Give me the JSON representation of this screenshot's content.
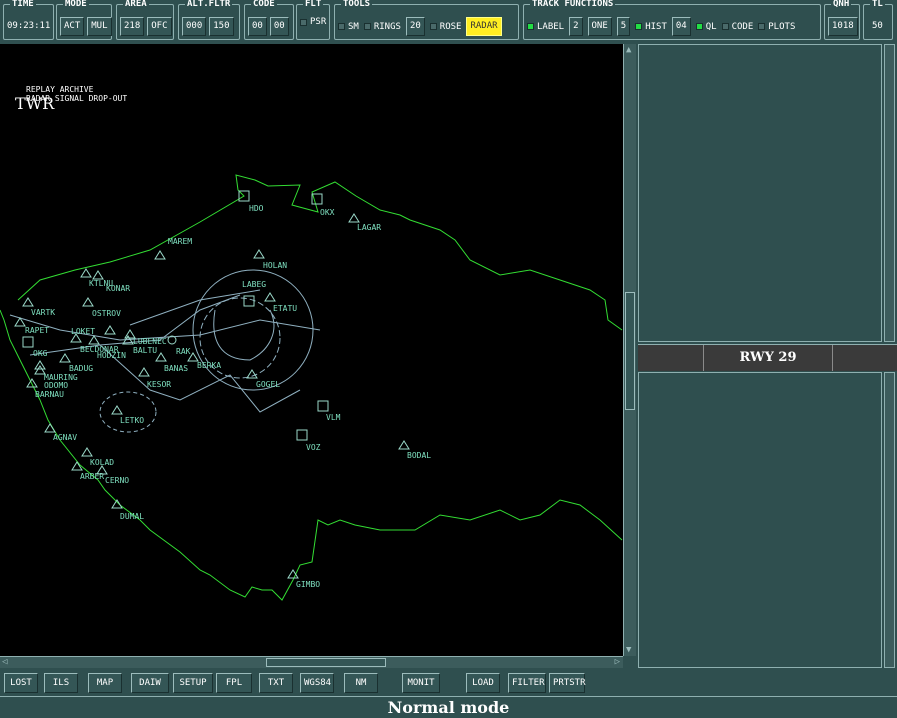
{
  "toolbar": {
    "time": {
      "title": "TIME",
      "value": "09:23:11"
    },
    "mode": {
      "title": "MODE",
      "buttons": [
        "ACT",
        "MUL"
      ]
    },
    "area": {
      "title": "AREA",
      "buttons": [
        "218",
        "OFC"
      ]
    },
    "alt_fltr": {
      "title": "ALT.FLTR",
      "buttons": [
        "000",
        "150"
      ]
    },
    "code": {
      "title": "CODE",
      "buttons": [
        "00",
        "00"
      ]
    },
    "flt": {
      "title": "FLT",
      "psr": {
        "label": "PSR",
        "checked": false
      }
    },
    "tools": {
      "title": "TOOLS",
      "sm": {
        "label": "SM",
        "checked": false
      },
      "rings": {
        "label": "RINGS",
        "checked": false
      },
      "rings_value": "20",
      "rose": {
        "label": "ROSE",
        "checked": false
      },
      "radar": "RADAR"
    },
    "track": {
      "title": "TRACK FUNCTIONS",
      "label": {
        "label": "LABEL",
        "checked": true
      },
      "label_value": "2",
      "one": "ONE",
      "one_value": "5",
      "hist": {
        "label": "HIST",
        "checked": true
      },
      "hist_value": "04",
      "ql": {
        "label": "QL",
        "checked": true
      },
      "code": {
        "label": "CODE",
        "checked": false
      },
      "plots": {
        "label": "PLOTS",
        "checked": false
      }
    },
    "qnh": {
      "title": "QNH",
      "value": "1018"
    },
    "tl": {
      "title": "TL",
      "value": "50"
    }
  },
  "map": {
    "title": "TWR",
    "messages": [
      "REPLAY ARCHIVE",
      "RADAR SIGNAL DROP-OUT"
    ],
    "waypoints": [
      "HDO",
      "OKX",
      "LAGAR",
      "MAREM",
      "HOLAN",
      "KTLNU",
      "KONAR",
      "LABEG",
      "ETATU",
      "VARTK",
      "OSTROV",
      "RAPET",
      "LOKET",
      "OKG",
      "BECDONAR",
      "HODZIN",
      "LUBENEC",
      "BALTU",
      "RAK",
      "BERKA",
      "BANAS",
      "BADUG",
      "MAURING",
      "ODOMO",
      "BARNAU",
      "KESOR",
      "GOGEL",
      "LETKO",
      "VLM",
      "VOZ",
      "BODAL",
      "AGNAV",
      "KOLAD",
      "ARBER",
      "CERNO",
      "DUMAL",
      "GIMBO"
    ],
    "colors": {
      "border": "#33dd33",
      "airspace": "#8fb0c0",
      "labels": "#7fe0c0"
    }
  },
  "runway": {
    "label": "RWY  29"
  },
  "bottom_buttons": [
    "LOST",
    "ILS",
    "MAP",
    "DAIW",
    "SETUP",
    "FPL",
    "TXT",
    "WGS84",
    "NM",
    "MONIT",
    "LOAD",
    "FILTER",
    "PRTSTR"
  ],
  "status": "Normal mode"
}
